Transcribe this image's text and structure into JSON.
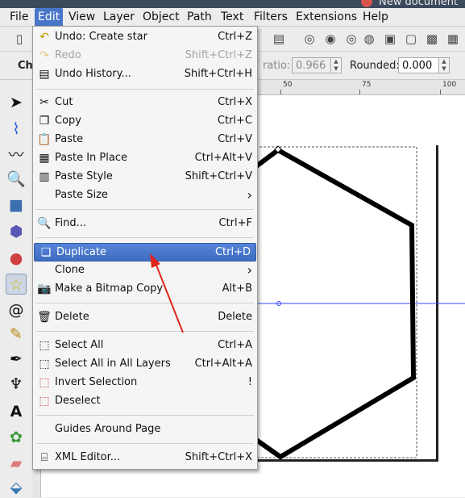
{
  "window": {
    "title": "New document"
  },
  "menubar": {
    "items": [
      "File",
      "Edit",
      "View",
      "Layer",
      "Object",
      "Path",
      "Text",
      "Filters",
      "Extensions",
      "Help"
    ],
    "active": "Edit"
  },
  "toolbar2": {
    "left_label": "Ch",
    "ratio_label": "ratio:",
    "ratio_value": "0.966",
    "rounded_label": "Rounded:",
    "rounded_value": "0.000"
  },
  "ruler": {
    "ticks": [
      "50",
      "75",
      "100"
    ]
  },
  "edit_menu": {
    "items": [
      {
        "label": "Undo: Create star",
        "shortcut": "Ctrl+Z",
        "icon": "undo-icon",
        "disabled": false
      },
      {
        "label": "Redo",
        "shortcut": "Shift+Ctrl+Z",
        "icon": "redo-icon",
        "disabled": true
      },
      {
        "label": "Undo History...",
        "shortcut": "Shift+Ctrl+H",
        "icon": "undo-history-icon",
        "disabled": false
      },
      {
        "label": "Cut",
        "shortcut": "Ctrl+X",
        "icon": "scissors-icon",
        "disabled": false
      },
      {
        "label": "Copy",
        "shortcut": "Ctrl+C",
        "icon": "copy-icon",
        "disabled": false
      },
      {
        "label": "Paste",
        "shortcut": "Ctrl+V",
        "icon": "paste-icon",
        "disabled": false
      },
      {
        "label": "Paste In Place",
        "shortcut": "Ctrl+Alt+V",
        "icon": "paste-in-place-icon",
        "disabled": false
      },
      {
        "label": "Paste Style",
        "shortcut": "Shift+Ctrl+V",
        "icon": "paste-style-icon",
        "disabled": false
      },
      {
        "label": "Paste Size",
        "shortcut": "",
        "icon": "",
        "disabled": false,
        "submenu": true
      },
      {
        "label": "Find...",
        "shortcut": "Ctrl+F",
        "icon": "find-icon",
        "disabled": false
      },
      {
        "label": "Duplicate",
        "shortcut": "Ctrl+D",
        "icon": "duplicate-icon",
        "disabled": false,
        "highlighted": true
      },
      {
        "label": "Clone",
        "shortcut": "",
        "icon": "",
        "disabled": false,
        "submenu": true
      },
      {
        "label": "Make a Bitmap Copy",
        "shortcut": "Alt+B",
        "icon": "camera-icon",
        "disabled": false
      },
      {
        "label": "Delete",
        "shortcut": "Delete",
        "icon": "trash-icon",
        "disabled": false
      },
      {
        "label": "Select All",
        "shortcut": "Ctrl+A",
        "icon": "select-all-icon",
        "disabled": false
      },
      {
        "label": "Select All in All Layers",
        "shortcut": "Ctrl+Alt+A",
        "icon": "select-all-layers-icon",
        "disabled": false
      },
      {
        "label": "Invert Selection",
        "shortcut": "!",
        "icon": "invert-selection-icon",
        "disabled": false
      },
      {
        "label": "Deselect",
        "shortcut": "",
        "icon": "deselect-icon",
        "disabled": false
      },
      {
        "label": "Guides Around Page",
        "shortcut": "",
        "icon": "",
        "disabled": false
      },
      {
        "label": "XML Editor...",
        "shortcut": "Shift+Ctrl+X",
        "icon": "xml-editor-icon",
        "disabled": false
      }
    ]
  },
  "colors": {
    "highlight": "#3e6cc0",
    "annotation_arrow": "#e0261b",
    "shape_stroke": "#000000",
    "guide": "#3344ff"
  }
}
